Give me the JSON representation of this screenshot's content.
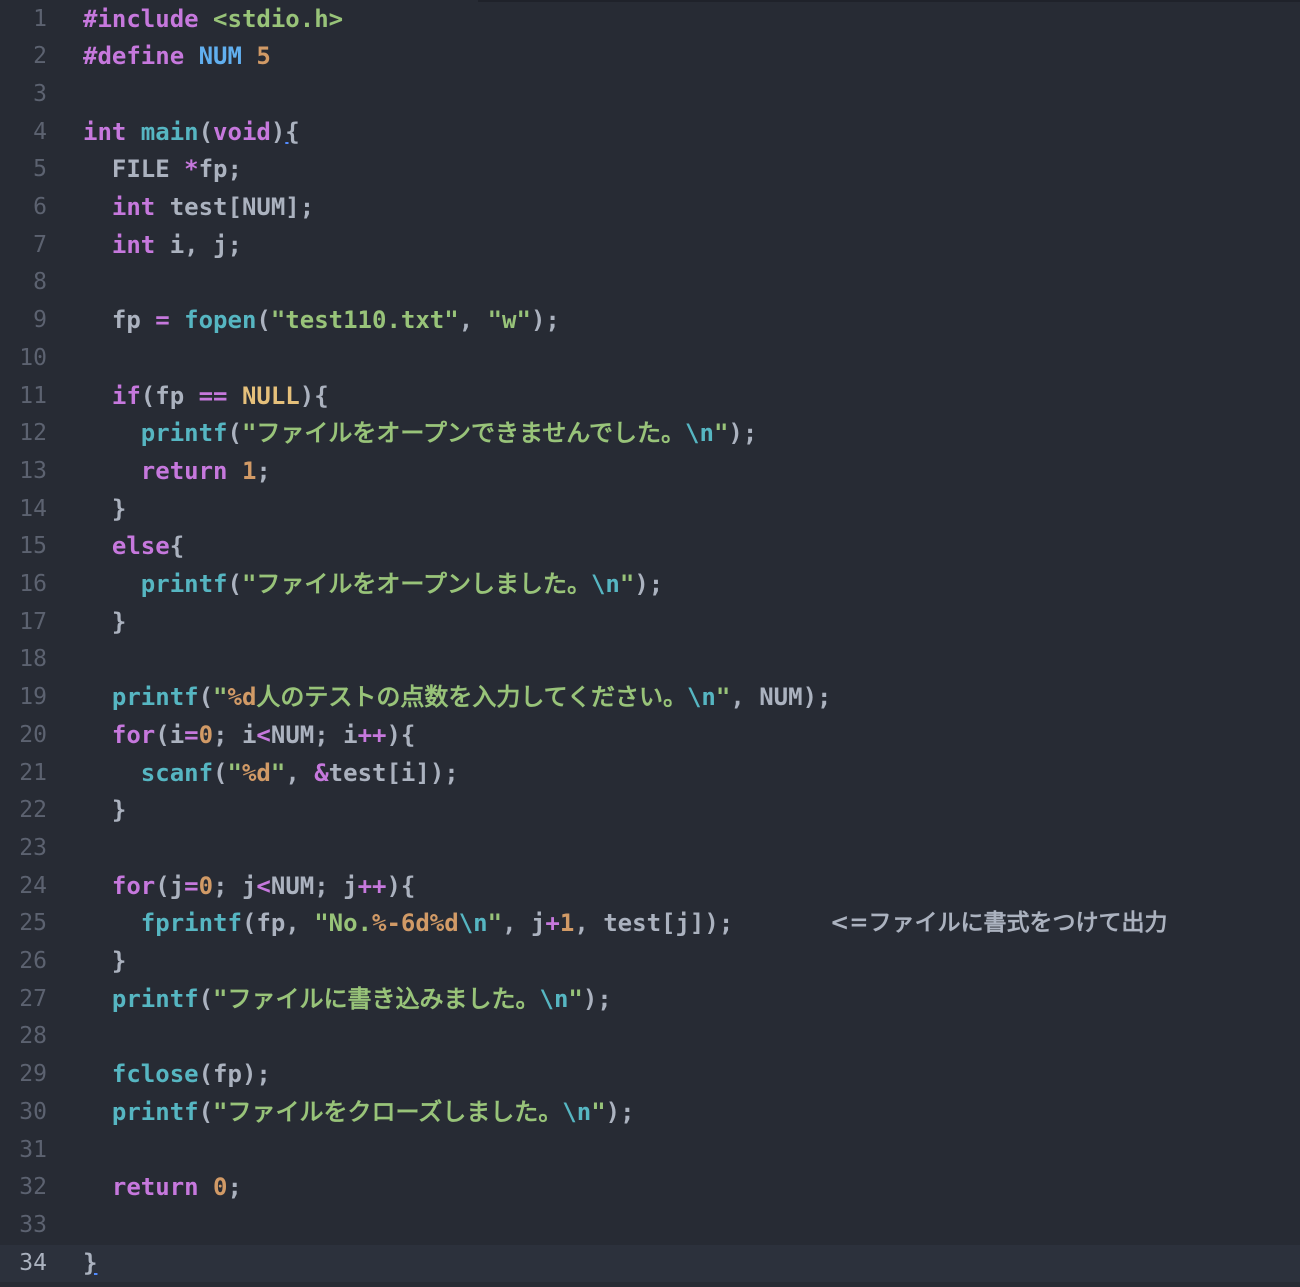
{
  "editor": {
    "current_line": 34,
    "colors": {
      "background": "#272b34",
      "keyword": "#c678dd",
      "function": "#56b6c2",
      "string": "#98c379",
      "number": "#d19a66",
      "constant": "#e5c07b",
      "macro_name": "#61afef",
      "plain": "#abb2bf",
      "line_number": "#5c6270"
    },
    "annotation": "<=ファイルに書式をつけて出力",
    "lines": [
      {
        "n": "1",
        "tokens": [
          [
            "kw",
            "#include "
          ],
          [
            "str",
            "<stdio.h>"
          ]
        ]
      },
      {
        "n": "2",
        "tokens": [
          [
            "kw",
            "#define "
          ],
          [
            "def",
            "NUM "
          ],
          [
            "num",
            "5"
          ]
        ]
      },
      {
        "n": "3",
        "tokens": []
      },
      {
        "n": "4",
        "tokens": [
          [
            "kw",
            "int "
          ],
          [
            "fn",
            "main"
          ],
          [
            "plain",
            "("
          ],
          [
            "kw",
            "void"
          ],
          [
            "plain",
            ")"
          ],
          [
            "braceu",
            "{"
          ]
        ]
      },
      {
        "n": "5",
        "tokens": [
          [
            "plain",
            "  FILE "
          ],
          [
            "op",
            "*"
          ],
          [
            "plain",
            "fp;"
          ]
        ]
      },
      {
        "n": "6",
        "tokens": [
          [
            "kw",
            "  int "
          ],
          [
            "plain",
            "test[NUM];"
          ]
        ]
      },
      {
        "n": "7",
        "tokens": [
          [
            "kw",
            "  int "
          ],
          [
            "plain",
            "i, j;"
          ]
        ]
      },
      {
        "n": "8",
        "tokens": []
      },
      {
        "n": "9",
        "tokens": [
          [
            "plain",
            "  fp "
          ],
          [
            "op",
            "= "
          ],
          [
            "fn",
            "fopen"
          ],
          [
            "plain",
            "("
          ],
          [
            "str",
            "\"test110.txt\""
          ],
          [
            "plain",
            ", "
          ],
          [
            "str",
            "\"w\""
          ],
          [
            "plain",
            ");"
          ]
        ]
      },
      {
        "n": "10",
        "tokens": []
      },
      {
        "n": "11",
        "tokens": [
          [
            "kw",
            "  if"
          ],
          [
            "plain",
            "(fp "
          ],
          [
            "op",
            "== "
          ],
          [
            "const",
            "NULL"
          ],
          [
            "plain",
            "){"
          ]
        ]
      },
      {
        "n": "12",
        "tokens": [
          [
            "fn",
            "    printf"
          ],
          [
            "plain",
            "("
          ],
          [
            "str",
            "\"ファイルをオープンできませんでした。"
          ],
          [
            "esc",
            "\\n"
          ],
          [
            "str",
            "\""
          ],
          [
            "plain",
            ");"
          ]
        ]
      },
      {
        "n": "13",
        "tokens": [
          [
            "kw",
            "    return "
          ],
          [
            "num",
            "1"
          ],
          [
            "plain",
            ";"
          ]
        ]
      },
      {
        "n": "14",
        "tokens": [
          [
            "plain",
            "  }"
          ]
        ]
      },
      {
        "n": "15",
        "tokens": [
          [
            "kw",
            "  else"
          ],
          [
            "plain",
            "{"
          ]
        ]
      },
      {
        "n": "16",
        "tokens": [
          [
            "fn",
            "    printf"
          ],
          [
            "plain",
            "("
          ],
          [
            "str",
            "\"ファイルをオープンしました。"
          ],
          [
            "esc",
            "\\n"
          ],
          [
            "str",
            "\""
          ],
          [
            "plain",
            ");"
          ]
        ]
      },
      {
        "n": "17",
        "tokens": [
          [
            "plain",
            "  }"
          ]
        ]
      },
      {
        "n": "18",
        "tokens": []
      },
      {
        "n": "19",
        "tokens": [
          [
            "fn",
            "  printf"
          ],
          [
            "plain",
            "("
          ],
          [
            "str",
            "\""
          ],
          [
            "num",
            "%d"
          ],
          [
            "str",
            "人のテストの点数を入力してください。"
          ],
          [
            "esc",
            "\\n"
          ],
          [
            "str",
            "\""
          ],
          [
            "plain",
            ", NUM);"
          ]
        ]
      },
      {
        "n": "20",
        "tokens": [
          [
            "kw",
            "  for"
          ],
          [
            "plain",
            "(i"
          ],
          [
            "op",
            "="
          ],
          [
            "num",
            "0"
          ],
          [
            "plain",
            "; i"
          ],
          [
            "op",
            "<"
          ],
          [
            "plain",
            "NUM; i"
          ],
          [
            "op",
            "++"
          ],
          [
            "plain",
            "){"
          ]
        ]
      },
      {
        "n": "21",
        "tokens": [
          [
            "fn",
            "    scanf"
          ],
          [
            "plain",
            "("
          ],
          [
            "str",
            "\""
          ],
          [
            "num",
            "%d"
          ],
          [
            "str",
            "\""
          ],
          [
            "plain",
            ", "
          ],
          [
            "op",
            "&"
          ],
          [
            "plain",
            "test[i]);"
          ]
        ]
      },
      {
        "n": "22",
        "tokens": [
          [
            "plain",
            "  }"
          ]
        ]
      },
      {
        "n": "23",
        "tokens": []
      },
      {
        "n": "24",
        "tokens": [
          [
            "kw",
            "  for"
          ],
          [
            "plain",
            "(j"
          ],
          [
            "op",
            "="
          ],
          [
            "num",
            "0"
          ],
          [
            "plain",
            "; j"
          ],
          [
            "op",
            "<"
          ],
          [
            "plain",
            "NUM; j"
          ],
          [
            "op",
            "++"
          ],
          [
            "plain",
            "){"
          ]
        ]
      },
      {
        "n": "25",
        "tokens": [
          [
            "fn",
            "    fprintf"
          ],
          [
            "plain",
            "(fp, "
          ],
          [
            "str",
            "\"No."
          ],
          [
            "num",
            "%-6d%d"
          ],
          [
            "esc",
            "\\n"
          ],
          [
            "str",
            "\""
          ],
          [
            "plain",
            ", j"
          ],
          [
            "op",
            "+"
          ],
          [
            "num",
            "1"
          ],
          [
            "plain",
            ", test[j]);"
          ]
        ],
        "annotated": true
      },
      {
        "n": "26",
        "tokens": [
          [
            "plain",
            "  }"
          ]
        ]
      },
      {
        "n": "27",
        "tokens": [
          [
            "fn",
            "  printf"
          ],
          [
            "plain",
            "("
          ],
          [
            "str",
            "\"ファイルに書き込みました。"
          ],
          [
            "esc",
            "\\n"
          ],
          [
            "str",
            "\""
          ],
          [
            "plain",
            ");"
          ]
        ]
      },
      {
        "n": "28",
        "tokens": []
      },
      {
        "n": "29",
        "tokens": [
          [
            "fn",
            "  fclose"
          ],
          [
            "plain",
            "(fp);"
          ]
        ]
      },
      {
        "n": "30",
        "tokens": [
          [
            "fn",
            "  printf"
          ],
          [
            "plain",
            "("
          ],
          [
            "str",
            "\"ファイルをクローズしました。"
          ],
          [
            "esc",
            "\\n"
          ],
          [
            "str",
            "\""
          ],
          [
            "plain",
            ");"
          ]
        ]
      },
      {
        "n": "31",
        "tokens": []
      },
      {
        "n": "32",
        "tokens": [
          [
            "kw",
            "  return "
          ],
          [
            "num",
            "0"
          ],
          [
            "plain",
            ";"
          ]
        ]
      },
      {
        "n": "33",
        "tokens": []
      },
      {
        "n": "34",
        "tokens": [
          [
            "braceu",
            "}"
          ]
        ]
      }
    ]
  }
}
